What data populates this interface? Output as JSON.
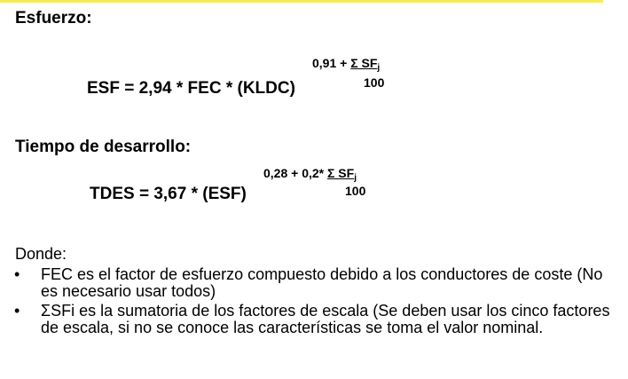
{
  "sections": {
    "esfuerzo": {
      "heading": "Esfuerzo:",
      "formula": "ESF = 2,94 * FEC * (KLDC)",
      "exp_prefix": "0,91 + ",
      "exp_sum": "Σ SF",
      "exp_sub": "j",
      "exp_denominator": "100"
    },
    "tiempo": {
      "heading": "Tiempo de desarrollo:",
      "formula": "TDES = 3,67 * (ESF)",
      "exp_prefix": "0,28 + 0,2* ",
      "exp_sum": "Σ SF",
      "exp_sub": "j",
      "exp_denominator": "100"
    }
  },
  "donde": {
    "label": "Donde:",
    "bullet_symbol": "•",
    "items": [
      " FEC es el factor de esfuerzo compuesto debido a los conductores de coste (No es necesario usar todos)",
      "ΣSFi es la sumatoria de los factores de escala (Se deben usar los cinco factores de escala, si no se conoce las características se toma el valor nominal."
    ]
  },
  "colors": {
    "top_rule": "#f3ec5a",
    "text": "#000000"
  }
}
